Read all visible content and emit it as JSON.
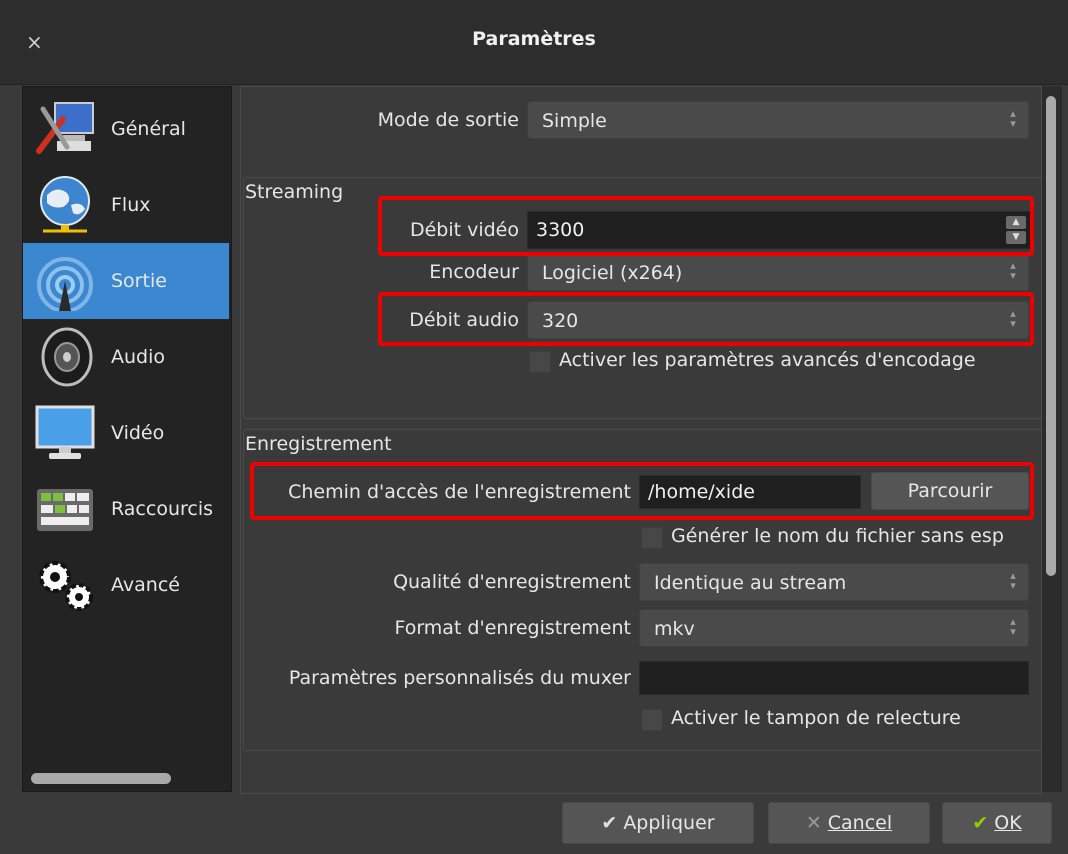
{
  "window": {
    "title": "Paramètres",
    "close_glyph": "×"
  },
  "sidebar": {
    "items": [
      {
        "label": "Général",
        "icon": "tools-monitor-icon"
      },
      {
        "label": "Flux",
        "icon": "globe-network-icon"
      },
      {
        "label": "Sortie",
        "icon": "broadcast-icon",
        "active": true
      },
      {
        "label": "Audio",
        "icon": "speaker-icon"
      },
      {
        "label": "Vidéo",
        "icon": "monitor-icon"
      },
      {
        "label": "Raccourcis",
        "icon": "keyboard-icon"
      },
      {
        "label": "Avancé",
        "icon": "gears-icon"
      }
    ]
  },
  "output": {
    "mode_label": "Mode de sortie",
    "mode_value": "Simple",
    "streaming": {
      "title": "Streaming",
      "video_bitrate_label": "Débit vidéo",
      "video_bitrate_value": "3300",
      "encoder_label": "Encodeur",
      "encoder_value": "Logiciel (x264)",
      "audio_bitrate_label": "Débit audio",
      "audio_bitrate_value": "320",
      "advanced_label": "Activer les paramètres avancés d'encodage"
    },
    "recording": {
      "title": "Enregistrement",
      "path_label": "Chemin d'accès de l'enregistrement",
      "path_value": "/home/xide",
      "browse_label": "Parcourir",
      "nospace_label": "Générer le nom du fichier sans esp",
      "quality_label": "Qualité d'enregistrement",
      "quality_value": "Identique au stream",
      "format_label": "Format d'enregistrement",
      "format_value": "mkv",
      "muxer_label": "Paramètres personnalisés du muxer",
      "muxer_value": "",
      "replay_label": "Activer le tampon de relecture"
    }
  },
  "footer": {
    "apply_label": "Appliquer",
    "cancel_label": "Cancel",
    "ok_label": "OK"
  },
  "colors": {
    "accent": "#3c88d0",
    "highlight": "#e00000",
    "check_green": "#8cd000"
  }
}
